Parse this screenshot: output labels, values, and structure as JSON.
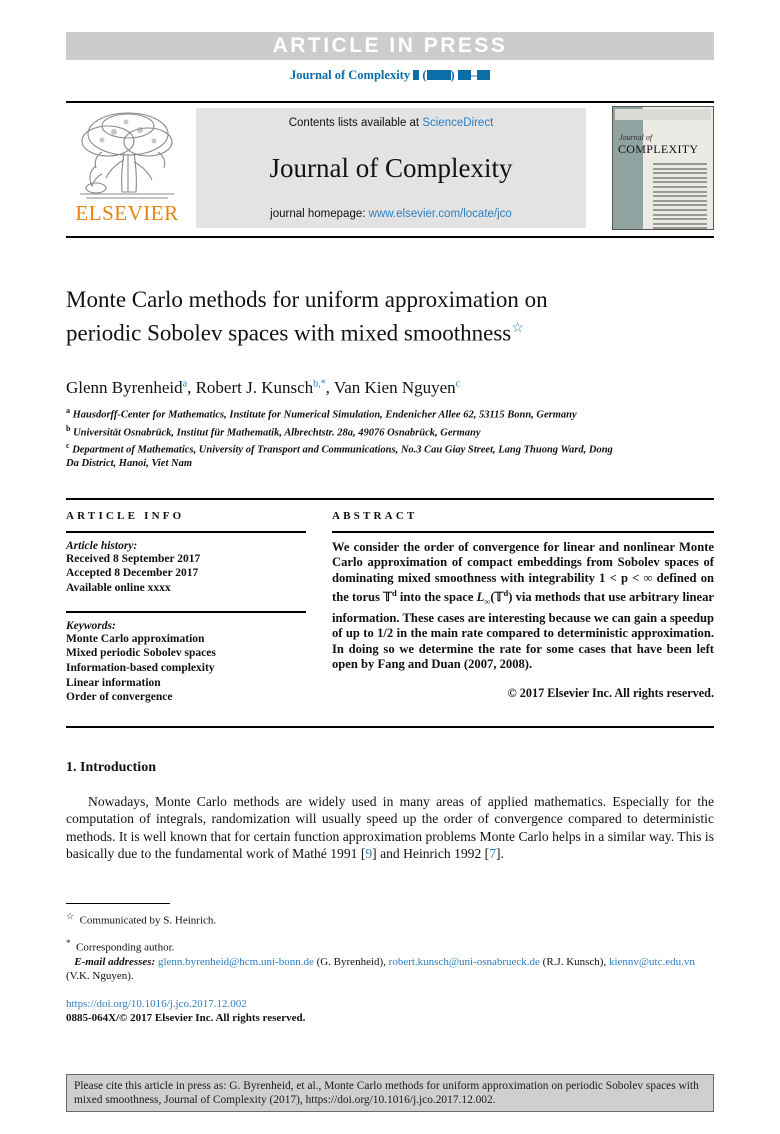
{
  "header": {
    "article_in_press": "ARTICLE  IN  PRESS",
    "journal_ref_prefix": "Journal of Complexity"
  },
  "masthead": {
    "elsevier_wordmark": "ELSEVIER",
    "contents_prefix": "Contents lists available at ",
    "sciencedirect_link": "ScienceDirect",
    "journal_title": "Journal of Complexity",
    "homepage_prefix": "journal homepage: ",
    "homepage_link": "www.elsevier.com/locate/jco",
    "cover_journal_of": "Journal of",
    "cover_complexity": "COMPLEXITY"
  },
  "article": {
    "title": "Monte Carlo methods for uniform approximation on periodic Sobolev spaces with mixed smoothness",
    "title_footnote_mark": "☆",
    "authors": [
      {
        "name": "Glenn Byrenheid",
        "mark": "a"
      },
      {
        "name": "Robert J. Kunsch",
        "mark": "b,*"
      },
      {
        "name": "Van Kien Nguyen",
        "mark": "c"
      }
    ],
    "affiliations": [
      {
        "mark": "a",
        "text": "Hausdorff-Center for Mathematics, Institute for Numerical Simulation, Endenicher Allee 62, 53115 Bonn, Germany"
      },
      {
        "mark": "b",
        "text": "Universität Osnabrück, Institut für Mathematik, Albrechtstr. 28a, 49076 Osnabrück, Germany"
      },
      {
        "mark": "c",
        "text": "Department of Mathematics, University of Transport and Communications, No.3 Cau Giay Street, Lang Thuong Ward, Dong Da District, Hanoi, Viet Nam"
      }
    ]
  },
  "article_info": {
    "heading": "ARTICLE INFO",
    "history_label": "Article history:",
    "history": [
      "Received 8 September 2017",
      "Accepted 8 December 2017",
      "Available online xxxx"
    ],
    "keywords_label": "Keywords:",
    "keywords": [
      "Monte Carlo approximation",
      "Mixed periodic Sobolev spaces",
      "Information-based complexity",
      "Linear information",
      "Order of convergence"
    ]
  },
  "abstract": {
    "heading": "ABSTRACT",
    "part1": "We consider the order of convergence for linear and nonlinear Monte Carlo approximation of compact embeddings from Sobolev spaces of dominating mixed smoothness with integrability 1 < p < ∞ defined on the torus ",
    "torus": "Т",
    "part2": " into the space ",
    "part3": " via methods that use arbitrary linear information. These cases are interesting because we can gain a speedup of up to 1/2 in the main rate compared to deterministic approximation. In doing so we determine the rate for some cases that have been left open by Fang and Duan (2007, 2008).",
    "copyright": "© 2017 Elsevier Inc. All rights reserved."
  },
  "introduction": {
    "heading": "1. Introduction",
    "paragraph_a": "Nowadays, Monte Carlo methods are widely used in many areas of applied mathematics. Especially for the computation of integrals, randomization will usually speed up the order of convergence compared to deterministic methods. It is well known that for certain function approximation problems Monte Carlo helps in a similar way. This is basically due to the fundamental work of Mathé 1991 [",
    "cite_1": "9",
    "paragraph_b": "] and Heinrich 1992 [",
    "cite_2": "7",
    "paragraph_c": "]."
  },
  "footnotes": {
    "communicated": "Communicated by S. Heinrich.",
    "corresponding": "Corresponding author.",
    "email_label": "E-mail addresses:",
    "emails": [
      {
        "address": "glenn.byrenheid@hcm.uni-bonn.de",
        "owner": "(G. Byrenheid)"
      },
      {
        "address": "robert.kunsch@uni-osnabrueck.de",
        "owner": "(R.J. Kunsch)"
      },
      {
        "address": "kiennv@utc.edu.vn",
        "owner": "(V.K. Nguyen)"
      }
    ],
    "doi": "https://doi.org/10.1016/j.jco.2017.12.002",
    "issn_line": "0885-064X/© 2017 Elsevier Inc. All rights reserved."
  },
  "citation_box": {
    "text": "Please cite this article in press as: G. Byrenheid, et al., Monte Carlo methods for uniform approximation on periodic Sobolev spaces with mixed smoothness, Journal of Complexity (2017), https://doi.org/10.1016/j.jco.2017.12.002."
  },
  "colors": {
    "link_blue": "#2b7fc1",
    "journal_ref_blue": "#0b6ea8",
    "banner_gray": "#e3e3e3",
    "aip_gray": "#cccccc",
    "elsevier_orange": "#e8820c"
  }
}
